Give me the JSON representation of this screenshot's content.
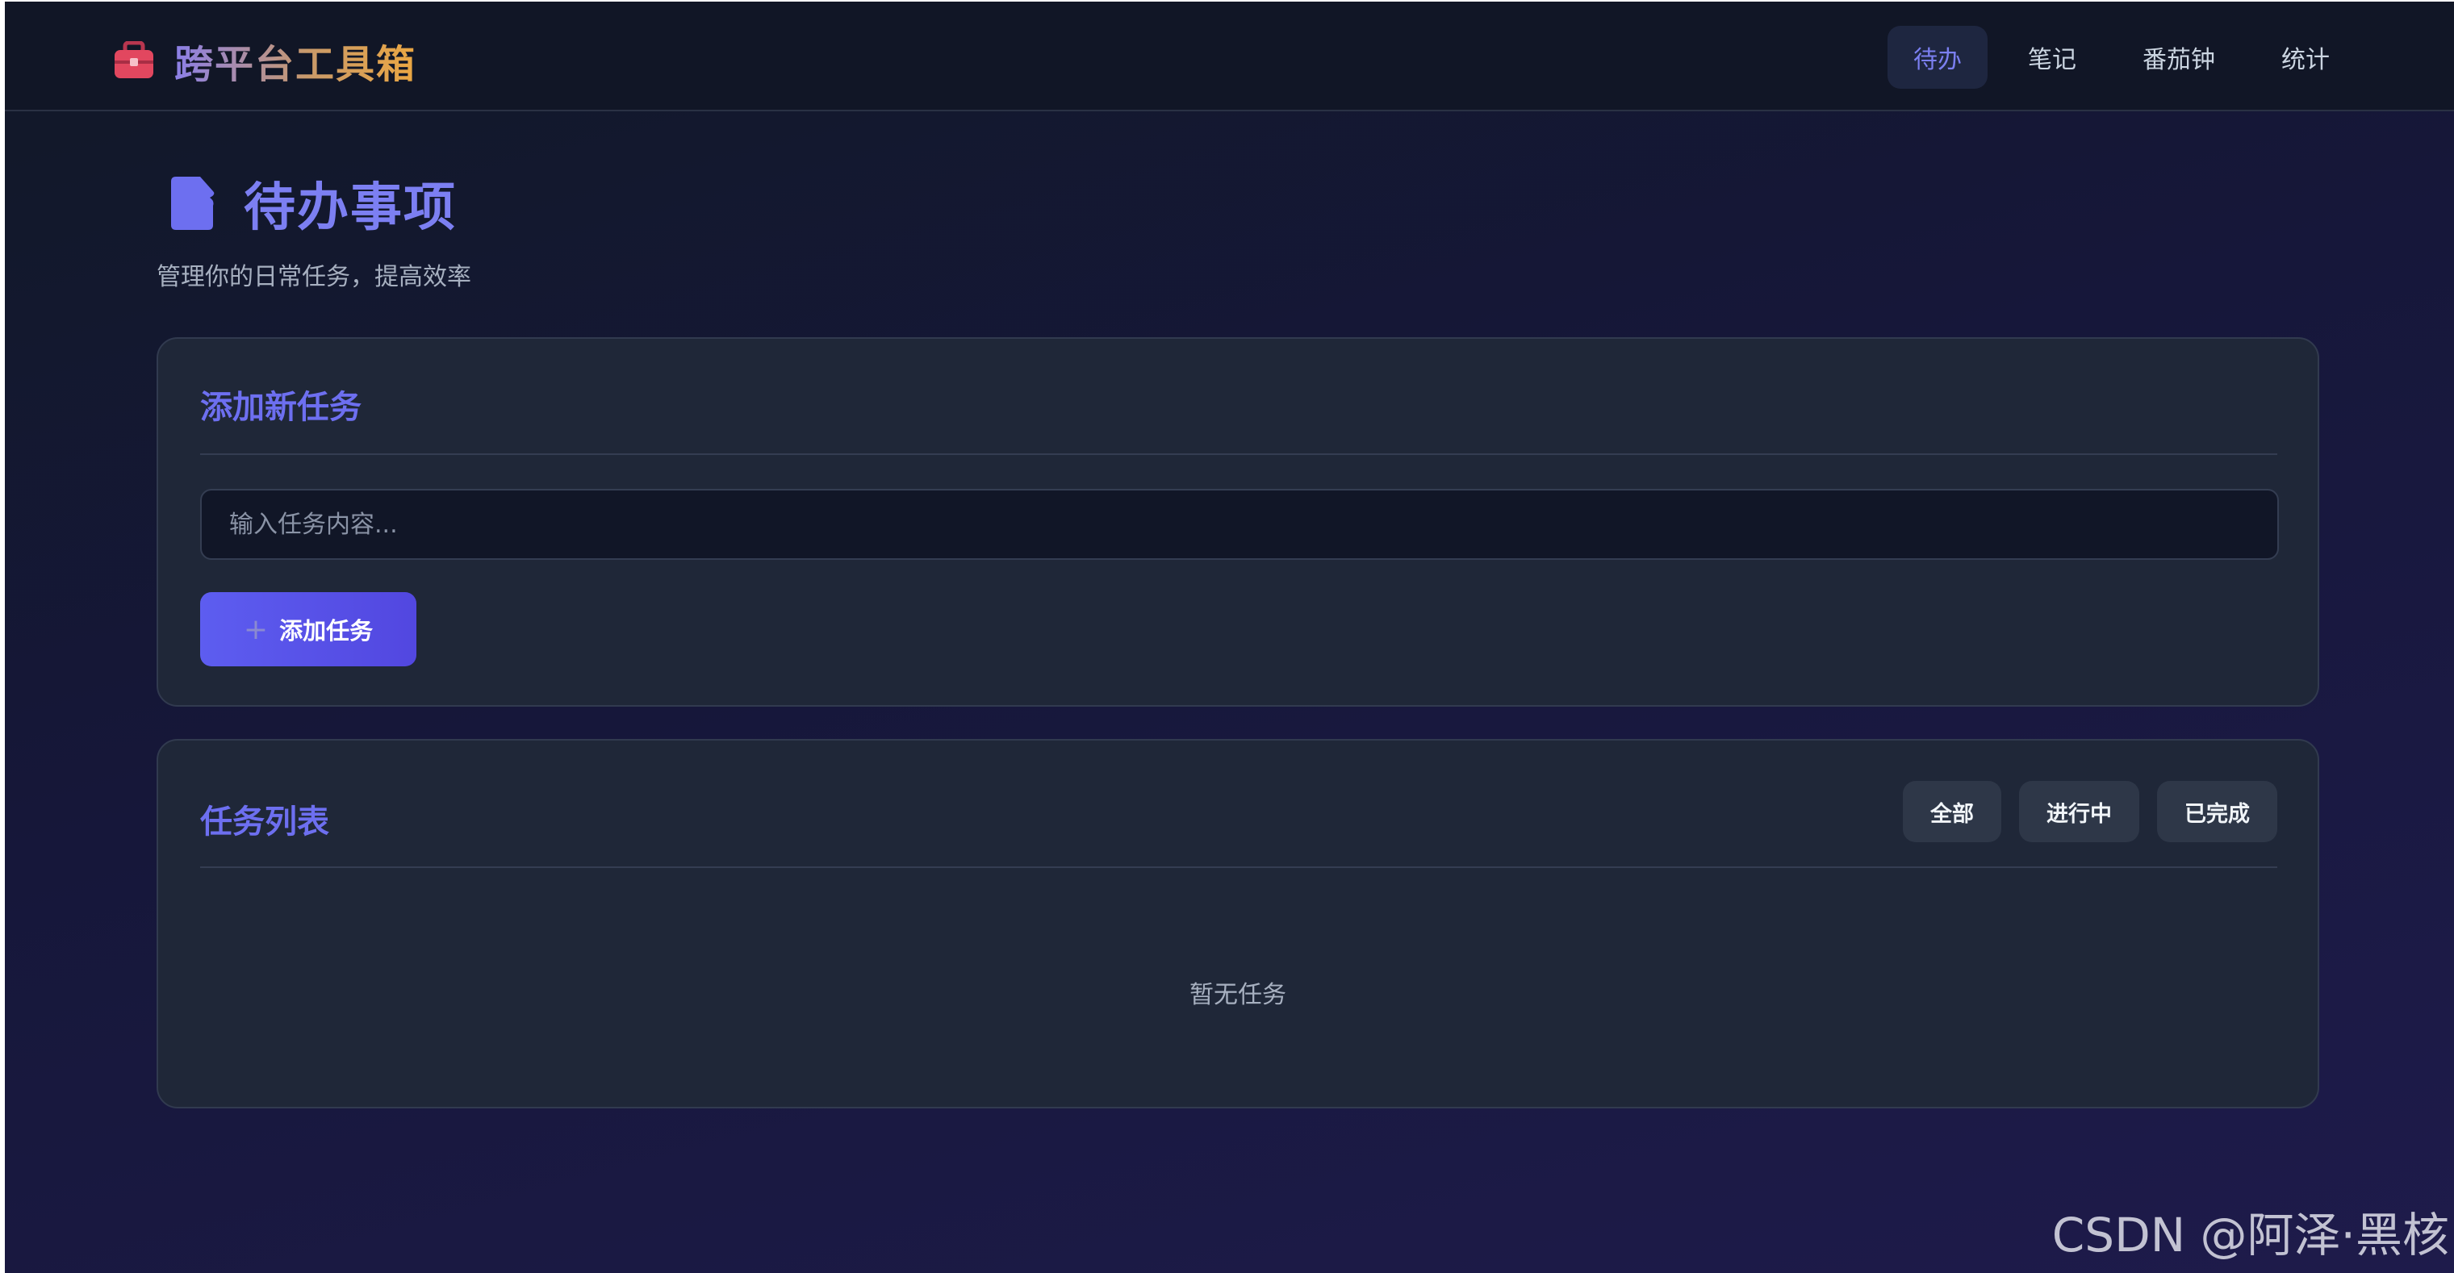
{
  "app": {
    "title": "跨平台工具箱",
    "icon": "toolbox-icon"
  },
  "nav": {
    "items": [
      {
        "label": "待办",
        "active": true
      },
      {
        "label": "笔记",
        "active": false
      },
      {
        "label": "番茄钟",
        "active": false
      },
      {
        "label": "统计",
        "active": false
      }
    ]
  },
  "page": {
    "icon": "document-icon",
    "title": "待办事项",
    "subtitle": "管理你的日常任务，提高效率"
  },
  "add_card": {
    "title": "添加新任务",
    "input": {
      "value": "",
      "placeholder": "输入任务内容..."
    },
    "button_label": "添加任务",
    "button_icon": "plus-icon"
  },
  "list_card": {
    "title": "任务列表",
    "filters": [
      "全部",
      "进行中",
      "已完成"
    ],
    "empty_text": "暂无任务"
  },
  "watermark": "CSDN @阿泽·黑核",
  "colors": {
    "accent": "#6d6ff0",
    "button_gradient_start": "#5d5df0",
    "button_gradient_end": "#5247e0",
    "card_bg": "#1f2738",
    "nav_active_bg": "#1e2640",
    "brand_gradient": [
      "#8b7fe8",
      "#c99a6a",
      "#eba742"
    ]
  }
}
